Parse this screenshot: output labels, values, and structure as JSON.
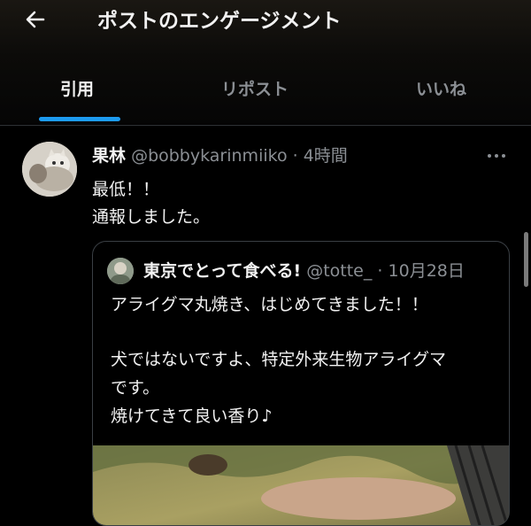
{
  "header": {
    "title": "ポストのエンゲージメント",
    "back_icon": "arrow-left-icon"
  },
  "tabs": [
    {
      "label": "引用",
      "active": true
    },
    {
      "label": "リポスト",
      "active": false
    },
    {
      "label": "いいね",
      "active": false
    }
  ],
  "post": {
    "author_name": "果林",
    "author_handle": "@bobbykarinmiiko",
    "separator": "·",
    "time": "4時間",
    "text_lines": [
      "最低！！",
      "通報しました。"
    ],
    "more_icon": "more-horizontal-icon"
  },
  "quote": {
    "author_name": "東京でとって食べる!",
    "author_handle": "@totte_",
    "separator": "·",
    "time": "10月28日",
    "text_lines": [
      "アライグマ丸焼き、はじめてきました！！",
      "",
      "犬ではないですよ、特定外来生物アライグマ",
      "です。",
      "焼けてきて良い香り♪"
    ]
  },
  "colors": {
    "background": "#000000",
    "accent": "#1d9bf0",
    "text_primary": "#e7e9ea",
    "text_secondary": "#71767b",
    "border": "#2f3336"
  }
}
